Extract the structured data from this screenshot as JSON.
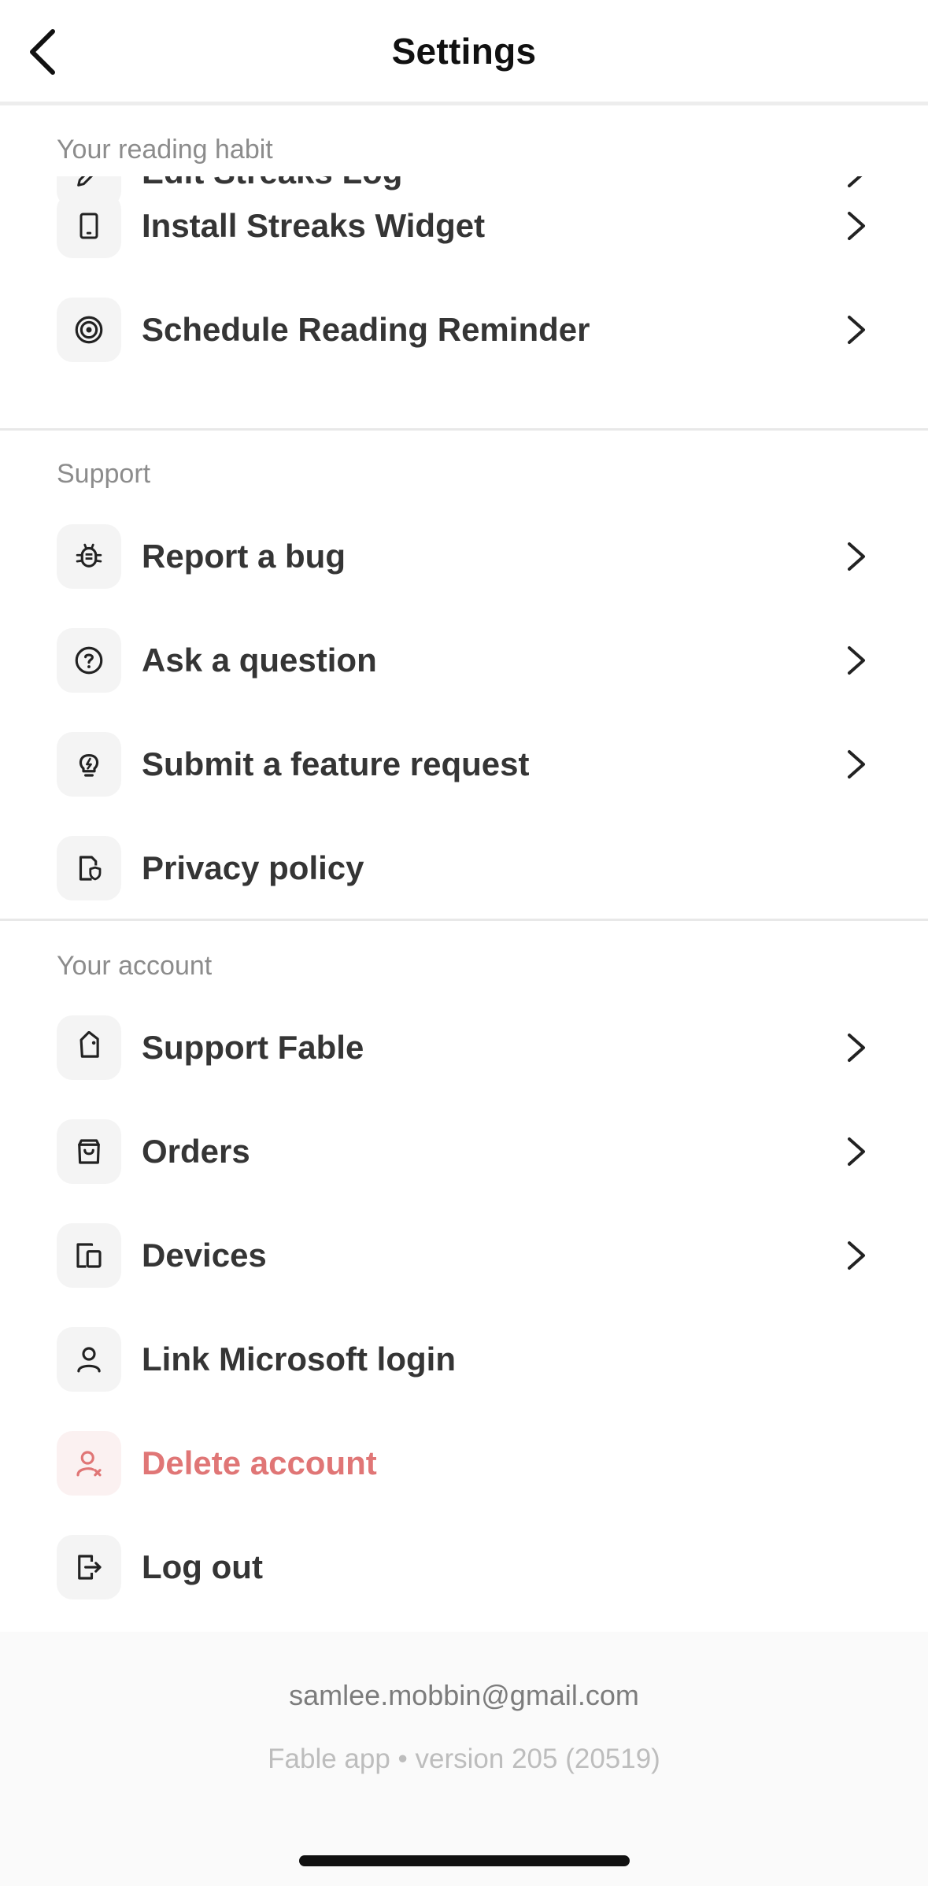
{
  "header": {
    "title": "Settings",
    "back_icon": "chevron-left-icon"
  },
  "sections": {
    "reading_habit": {
      "label": "Your reading habit",
      "items": [
        {
          "label": "Edit Streaks Log",
          "icon": "pencil-icon"
        },
        {
          "label": "Install Streaks Widget",
          "icon": "phone-widget-icon"
        },
        {
          "label": "Schedule Reading Reminder",
          "icon": "target-icon"
        }
      ]
    },
    "support": {
      "label": "Support",
      "items": [
        {
          "label": "Report a bug",
          "icon": "bug-icon"
        },
        {
          "label": "Ask a question",
          "icon": "question-circle-icon"
        },
        {
          "label": "Submit a feature request",
          "icon": "lightbulb-icon"
        },
        {
          "label": "Privacy policy",
          "icon": "document-shield-icon"
        }
      ]
    },
    "account": {
      "label": "Your account",
      "items": [
        {
          "label": "Support Fable",
          "icon": "tag-icon"
        },
        {
          "label": "Orders",
          "icon": "shopping-bag-icon"
        },
        {
          "label": "Devices",
          "icon": "devices-icon"
        },
        {
          "label": "Link Microsoft login",
          "icon": "user-icon"
        },
        {
          "label": "Delete account",
          "icon": "user-remove-icon"
        },
        {
          "label": "Log out",
          "icon": "logout-icon"
        }
      ]
    }
  },
  "footer": {
    "email": "samlee.mobbin@gmail.com",
    "version": "Fable app • version 205 (20519)"
  },
  "colors": {
    "danger": "#e07676",
    "text": "#353535",
    "muted": "#8c8c8c",
    "tile": "#f4f4f4"
  }
}
